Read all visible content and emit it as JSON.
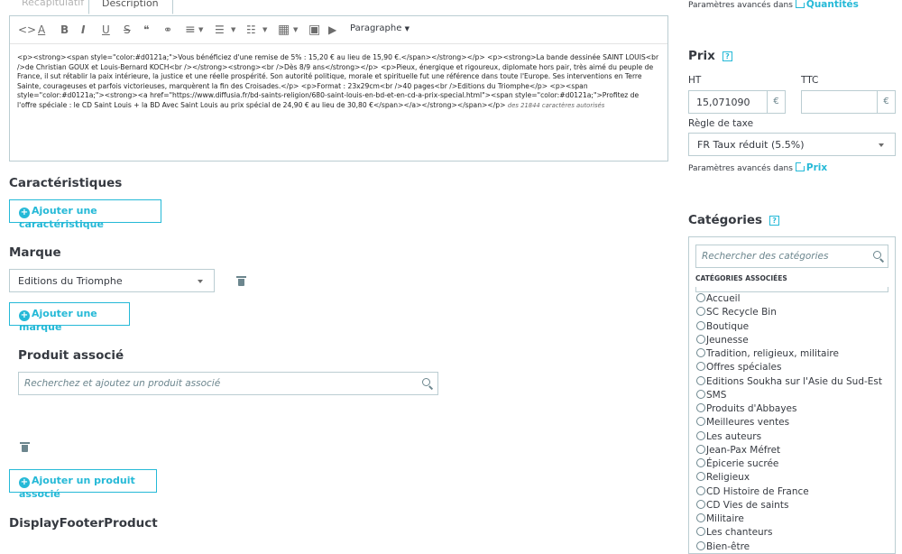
{
  "tabs": [
    {
      "label": "Récapitulatif"
    },
    {
      "label": "Description"
    }
  ],
  "editor": {
    "toolbar": {
      "code": "<>",
      "color": "A",
      "bold": "B",
      "italic": "I",
      "underline": "U",
      "strike": "S",
      "quote": "❝",
      "link": "⚭",
      "align": "≡",
      "bullets": "☰",
      "numbers": "☷",
      "table": "▦",
      "image": "▣",
      "video": "▶",
      "paragraph": "Paragraphe"
    },
    "content": "<p><strong><span style=\"color:#d0121a;\">Vous bénéficiez d'une remise de 5% : 15,20 € au lieu de 15,90 €.</span></strong></p> <p><strong>La bande dessinée SAINT LOUIS<br />de Christian GOUX et Louis-Bernard KOCH<br /></strong><strong><br />Dès 8/9 ans</strong></p> <p>Pieux, énergique et rigoureux, diplomate hors pair, très aimé du peuple de France, il sut rétablir la paix intérieure, la justice et une réelle prospérité. Son autorité politique, morale et spirituelle fut une référence dans toute l'Europe. Ses interventions en Terre Sainte, courageuses et parfois victorieuses, marquèrent la fin des Croisades.</p> <p>Format : 23x29cm<br />40 pages<br />Editions du Triomphe</p> <p><span style=\"color:#d0121a;\"><strong><a href=\"https://www.diffusia.fr/bd-saints-religion/680-saint-louis-en-bd-et-en-cd-a-prix-special.html\"><span style=\"color:#d0121a;\">Profitez de l'offre spéciale : le CD Saint Louis + la BD Avec Saint Louis au prix spécial de 24,90 € au lieu de 30,80 €</span></a></strong></span></p>",
    "counter": "des 21844 caractères autorisés"
  },
  "caracteristiques": {
    "title": "Caractéristiques",
    "add_button": "Ajouter une caractéristique"
  },
  "marque": {
    "title": "Marque",
    "selected": "Editions du Triomphe",
    "add_button": "Ajouter une marque"
  },
  "produit_associe": {
    "title": "Produit associé",
    "placeholder": "Recherchez et ajoutez un produit associé",
    "add_button": "Ajouter un produit associé"
  },
  "display_footer": {
    "title": "DisplayFooterProduct"
  },
  "quantites_note": {
    "text": "Paramètres avancés dans",
    "link": "Quantités"
  },
  "prix": {
    "title": "Prix",
    "help": "?",
    "ht_label": "HT",
    "ttc_label": "TTC",
    "ht_value": "15,071090",
    "ttc_value": "",
    "currency": "€",
    "tax_label": "Règle de taxe",
    "tax_value": "FR Taux réduit (5.5%)",
    "note_text": "Paramètres avancés dans",
    "note_link": "Prix"
  },
  "categories": {
    "title": "Catégories",
    "help": "?",
    "search_placeholder": "Rechercher des catégories",
    "assoc_label": "CATÉGORIES ASSOCIÉES",
    "items": [
      {
        "label": "Accueil"
      },
      {
        "label": "SC Recycle Bin"
      },
      {
        "label": "Boutique"
      },
      {
        "label": "Jeunesse"
      },
      {
        "label": "Tradition, religieux, militaire"
      },
      {
        "label": "Offres spéciales"
      },
      {
        "label": "Editions Soukha sur l'Asie du Sud-Est"
      },
      {
        "label": "SMS"
      },
      {
        "label": "Produits d'Abbayes"
      },
      {
        "label": "Meilleures ventes"
      },
      {
        "label": "Les auteurs"
      },
      {
        "label": "Jean-Pax Méfret"
      },
      {
        "label": "Épicerie sucrée"
      },
      {
        "label": "Religieux"
      },
      {
        "label": "CD Histoire de France"
      },
      {
        "label": "CD Vies de saints"
      },
      {
        "label": "Militaire"
      },
      {
        "label": "Les chanteurs"
      },
      {
        "label": "Bien-être"
      }
    ]
  }
}
